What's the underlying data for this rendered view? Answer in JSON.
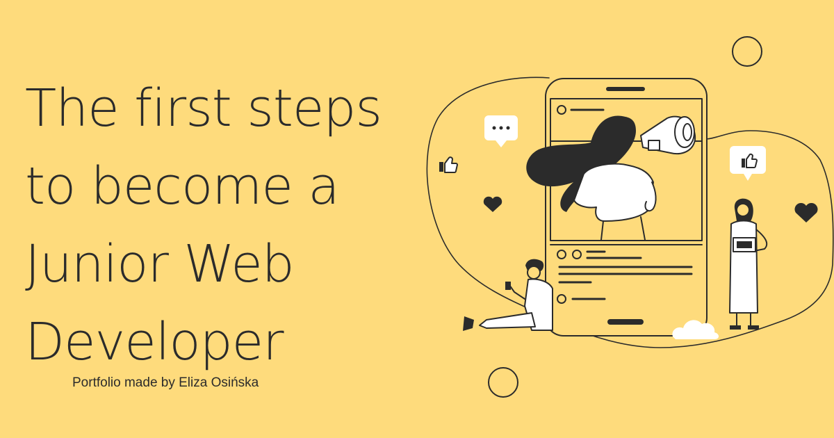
{
  "hero": {
    "title_lines": [
      "The first steps",
      "to become a",
      "Junior Web",
      "Developer"
    ],
    "subtitle": "Portfolio made by Eliza Osińska"
  },
  "colors": {
    "background": "#fedb7c",
    "ink": "#2b2b2b",
    "white": "#ffffff"
  },
  "illustration": {
    "icons": [
      "megaphone-icon",
      "like-icon",
      "heart-icon",
      "chat-bubble-icon",
      "cloud-icon",
      "laptop-icon",
      "phone-icon"
    ]
  }
}
